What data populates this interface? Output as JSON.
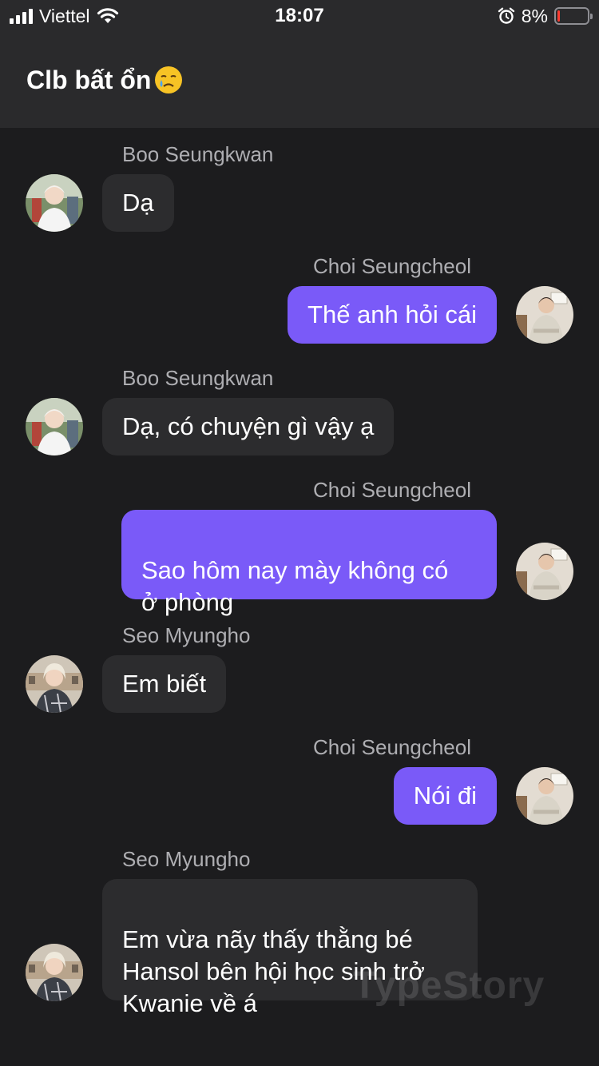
{
  "status": {
    "carrier": "Viettel",
    "time": "18:07",
    "battery_pct": "8%",
    "battery_level": 0.08,
    "icons": [
      "signal-icon",
      "wifi-icon",
      "alarm-icon",
      "battery-icon"
    ]
  },
  "chat": {
    "title": "Clb bất ổn"
  },
  "messages": [
    {
      "sender": "Boo Seungkwan",
      "text": "Dạ",
      "side": "in",
      "avatar": "avatar-boo-seungkwan"
    },
    {
      "sender": "Choi Seungcheol",
      "text": "Thế anh hỏi cái",
      "side": "out",
      "avatar": "avatar-choi-seungcheol"
    },
    {
      "sender": "Boo Seungkwan",
      "text": "Dạ, có chuyện gì vậy ạ",
      "side": "in",
      "avatar": "avatar-boo-seungkwan"
    },
    {
      "sender": "Choi Seungcheol",
      "text": "Sao hôm nay mày không có\nở phòng",
      "side": "out",
      "avatar": "avatar-choi-seungcheol"
    },
    {
      "sender": "Seo Myungho",
      "text": "Em biết",
      "side": "in",
      "avatar": "avatar-seo-myungho"
    },
    {
      "sender": "Choi Seungcheol",
      "text": "Nói đi",
      "side": "out",
      "avatar": "avatar-choi-seungcheol"
    },
    {
      "sender": "Seo Myungho",
      "text": "Em vừa nãy thấy thằng bé\nHansol bên hội học sinh trở\nKwanie về á",
      "side": "in",
      "avatar": "avatar-seo-myungho"
    }
  ],
  "watermark": "TypeStory",
  "colors": {
    "background": "#1c1c1e",
    "header": "#2a2a2c",
    "incoming_bubble": "#2c2c2e",
    "outgoing_bubble": "#7a5af8",
    "sender_name": "#aeaeb2"
  }
}
